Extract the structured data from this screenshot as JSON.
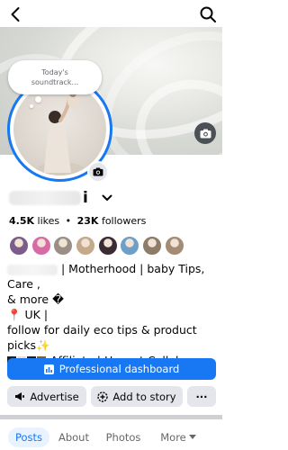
{
  "soundtrack_bubble": {
    "line1": "Today's",
    "line2": "soundtrack..."
  },
  "profile": {
    "name_visible_suffix": "i",
    "likes": "4.5K",
    "likes_label": "likes",
    "followers": "23K",
    "followers_label": "followers"
  },
  "friends": [
    {
      "color": "#7b5c8a"
    },
    {
      "color": "#d86aa6"
    },
    {
      "color": "#9a8f86"
    },
    {
      "color": "#c4a98a"
    },
    {
      "color": "#3a2b35"
    },
    {
      "color": "#6d9fc8"
    },
    {
      "color": "#8d7c69"
    },
    {
      "color": "#a48c74"
    }
  ],
  "bio": {
    "line1": "| Motherhood | baby Tips, Care ,",
    "line2": "& more �",
    "line3": "📍 UK |",
    "line4": "follow for daily eco tips & product",
    "line5": "picks✨",
    "line6": "Affiliate | Honest Collab"
  },
  "buttons": {
    "professional_dashboard": "Professional dashboard",
    "advertise": "Advertise",
    "add_to_story": "Add to story",
    "more": "···"
  },
  "tabs": [
    {
      "label": "Posts",
      "active": true
    },
    {
      "label": "About",
      "active": false
    },
    {
      "label": "Photos",
      "active": false
    },
    {
      "label": "More",
      "active": false
    }
  ],
  "colors": {
    "accent": "#1877f2",
    "secondary_button": "#e4e6eb",
    "active_tab_bg": "#e7f3ff"
  }
}
